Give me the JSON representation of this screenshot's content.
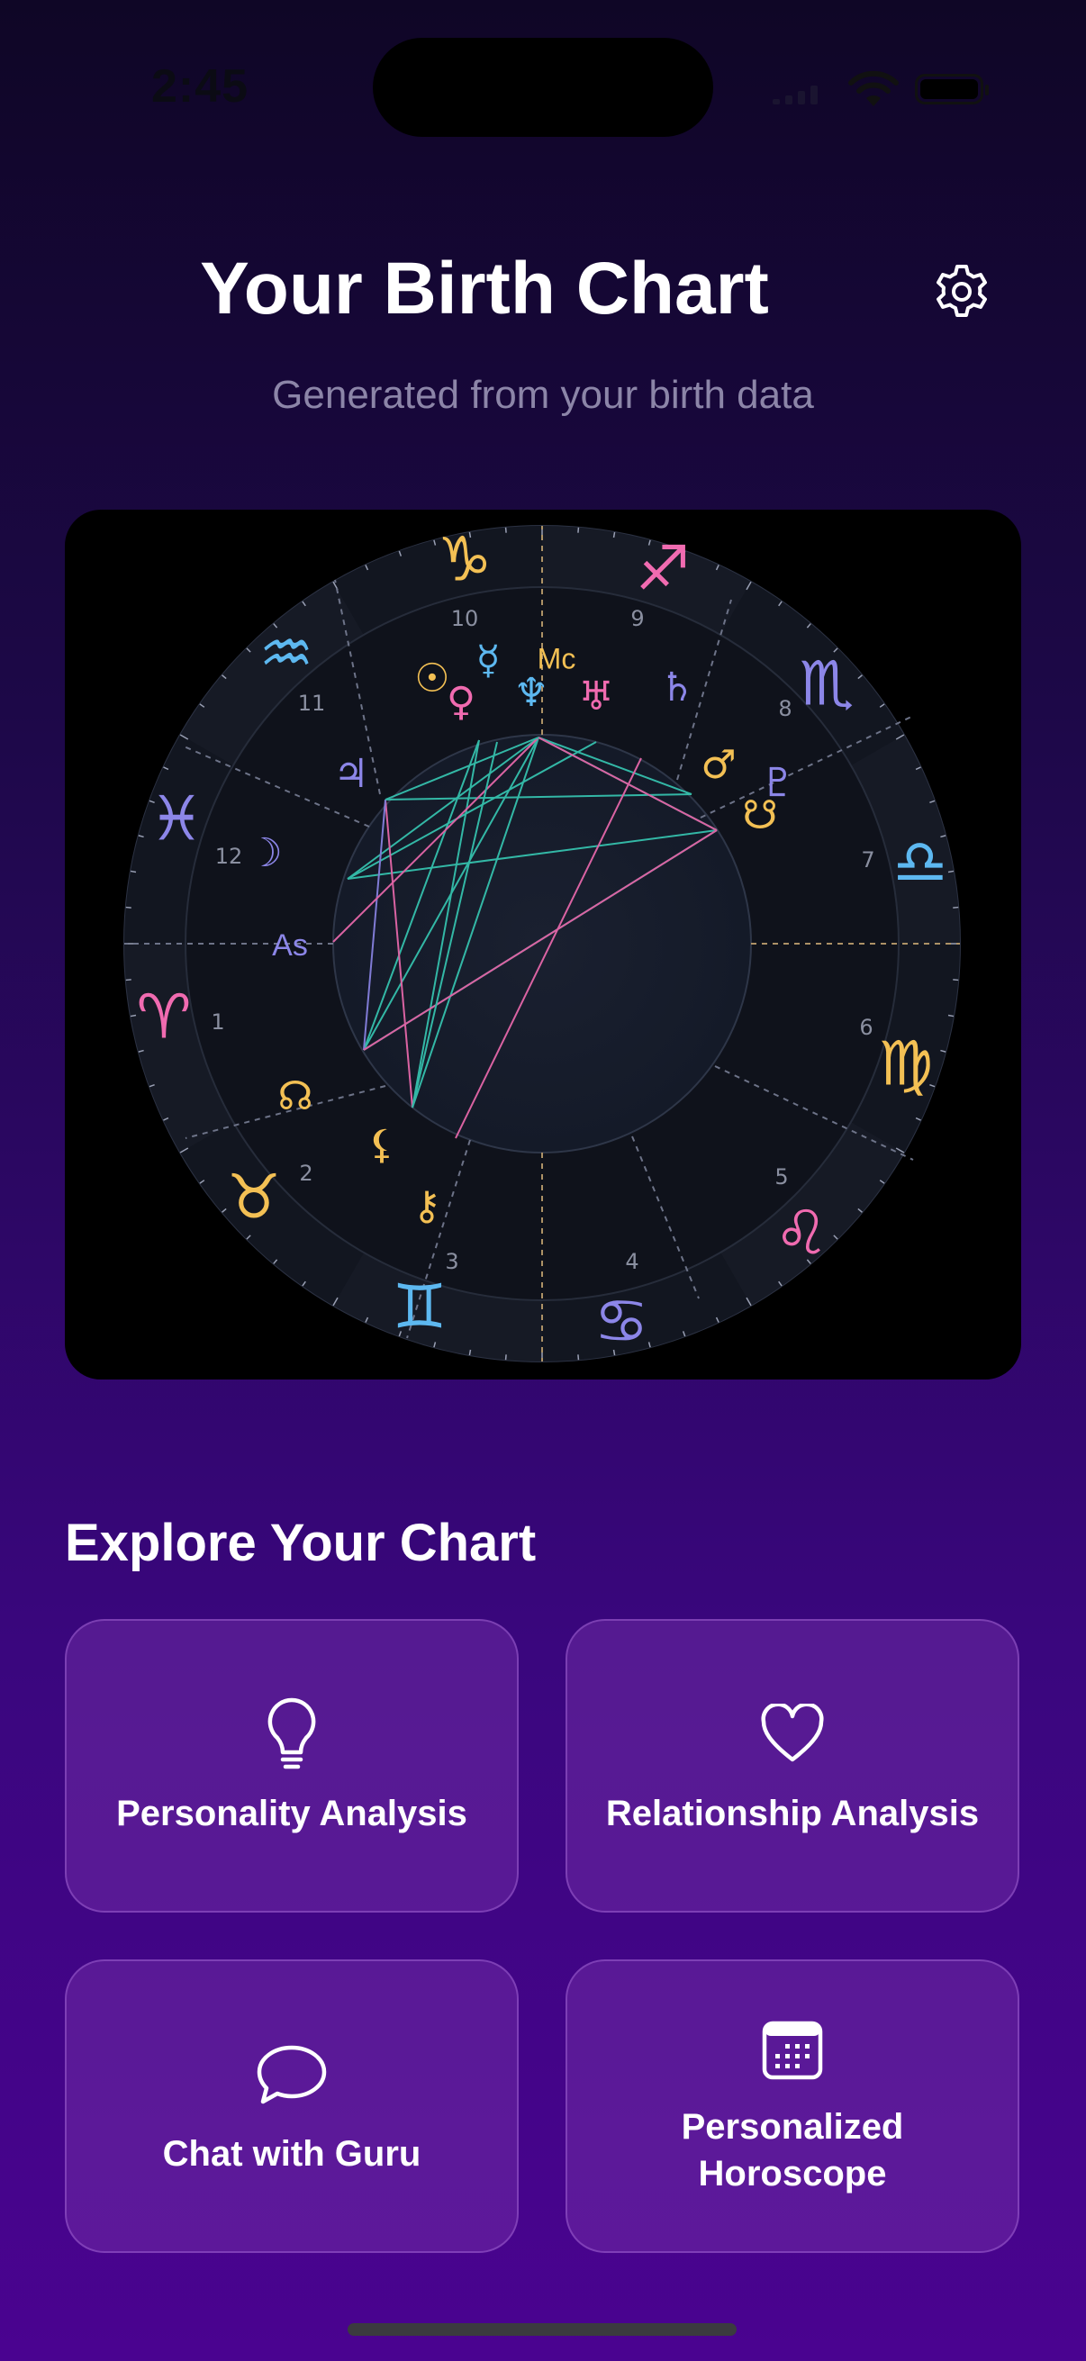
{
  "status_bar": {
    "time": "2:45"
  },
  "header": {
    "title": "Your Birth Chart",
    "subtitle": "Generated from your birth data"
  },
  "chart": {
    "angle_labels": {
      "ascendant": "As",
      "midheaven": "Mc"
    },
    "house_numbers": [
      "1",
      "2",
      "3",
      "4",
      "5",
      "6",
      "7",
      "8",
      "9",
      "10",
      "11",
      "12"
    ],
    "zodiac_glyphs": [
      "♈",
      "♉",
      "♊",
      "♋",
      "♌",
      "♍",
      "♎",
      "♏",
      "♐",
      "♑",
      "♒",
      "♓"
    ],
    "planet_glyphs": [
      "☉",
      "♀",
      "☿",
      "♆",
      "♅",
      "♄",
      "♂",
      "♇",
      "☋",
      "♃",
      "☽",
      "☊",
      "⚸",
      "⚷"
    ],
    "colors": {
      "pink": "#f06bb0",
      "gold": "#f3c054",
      "blue": "#5db8f0",
      "violet": "#8c86e8",
      "teal": "#37c9b4"
    }
  },
  "explore": {
    "title": "Explore Your Chart",
    "cards": [
      {
        "label": "Personality Analysis",
        "icon": "lightbulb-icon"
      },
      {
        "label": "Relationship Analysis",
        "icon": "heart-icon"
      },
      {
        "label": "Chat with Guru",
        "icon": "chat-bubble-icon"
      },
      {
        "label_line1": "Personalized",
        "label_line2": "Horoscope",
        "icon": "calendar-icon"
      }
    ]
  }
}
